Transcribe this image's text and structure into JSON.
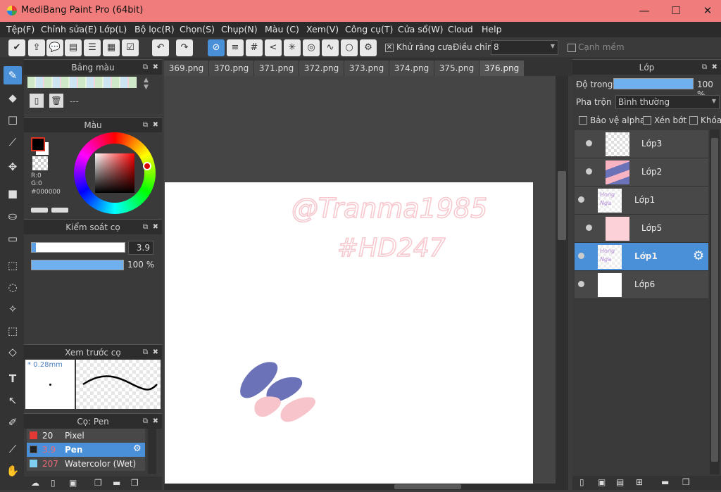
{
  "window": {
    "title": "MediBang Paint Pro (64bit)"
  },
  "menu": [
    "Tệp(F)",
    "Chỉnh sửa(E)",
    "Lớp(L)",
    "Bộ lọc(R)",
    "Chọn(S)",
    "Chụp(N)",
    "Màu (C)",
    "Xem(V)",
    "Công cụ(T)",
    "Cửa sổ(W)",
    "Cloud",
    "Help"
  ],
  "toolbar": {
    "antialias_label": "Khử răng cưa",
    "adjust_label": "Điều chỉnh",
    "adjust_value": "8",
    "soft_edge_label": "Cạnh mềm",
    "antialias_checked": true
  },
  "palette": {
    "title": "Bảng màu",
    "field_value": "---"
  },
  "color": {
    "title": "Màu",
    "r": "R:0",
    "g": "G:0",
    "hex": "#000000"
  },
  "brush_control": {
    "title": "Kiểm soát cọ",
    "size": "3.9",
    "opacity": "100 %"
  },
  "brush_preview": {
    "title": "Xem trước cọ",
    "size_label": "* 0.28mm"
  },
  "brush_list": {
    "title": "Cọ: Pen",
    "items": [
      {
        "size": "20",
        "name": "Pixel",
        "color": "#e53935"
      },
      {
        "size": "3.9",
        "name": "Pen",
        "color": "#222222",
        "selected": true
      },
      {
        "size": "207",
        "name": "Watercolor (Wet)",
        "color": "#7fd0f0"
      }
    ]
  },
  "tabs": [
    "369.png",
    "370.png",
    "371.png",
    "372.png",
    "373.png",
    "374.png",
    "375.png",
    "376.png"
  ],
  "active_tab": "376.png",
  "canvas_text": {
    "line1": "@Tranma1985",
    "line2": "#HD247"
  },
  "layers_panel": {
    "title": "Lớp",
    "opacity_label": "Độ trong",
    "opacity_value": "100 %",
    "blend_label": "Pha trộn",
    "blend_value": "Bình thường",
    "protect_alpha": "Bảo vệ alpha",
    "clip": "Xén bớt",
    "lock": "Khóa"
  },
  "layers": [
    {
      "name": "Lớp3"
    },
    {
      "name": "Lớp2"
    },
    {
      "name": "Lớp1"
    },
    {
      "name": "Lớp5"
    },
    {
      "name": "Lớp1",
      "selected": true
    },
    {
      "name": "Lớp6"
    }
  ]
}
